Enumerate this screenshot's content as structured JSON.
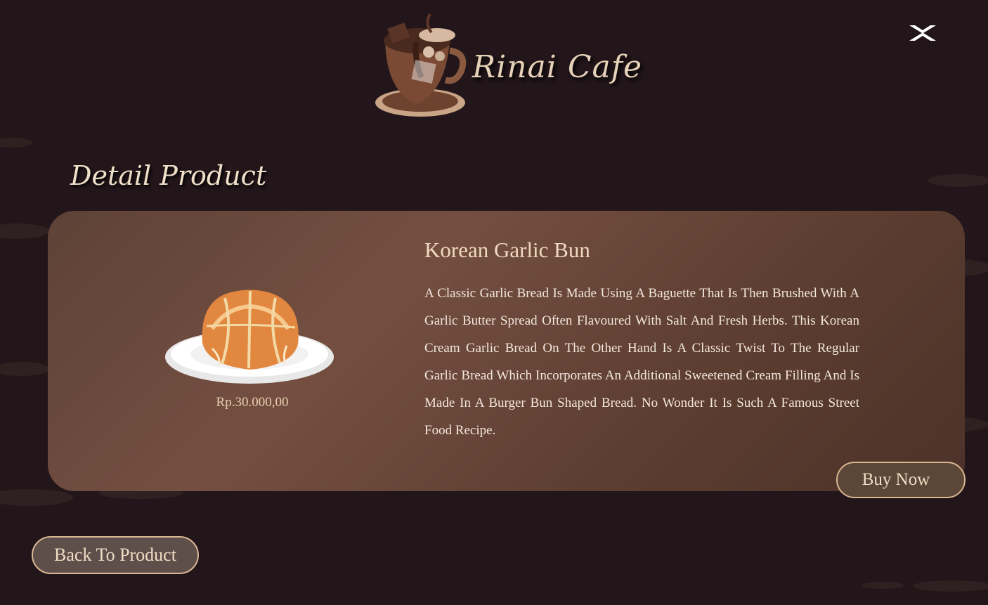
{
  "header": {
    "brand_name": "Rinai Cafe",
    "logo_icon": "coffee-cup-logo-icon",
    "close_icon": "close-icon"
  },
  "page": {
    "section_title": "Detail Product"
  },
  "product": {
    "name": "Korean Garlic Bun",
    "price": "Rp.30.000,00",
    "image_icon": "garlic-bun-image",
    "description": "A Classic Garlic Bread Is Made Using A Baguette That Is Then Brushed With A Garlic Butter Spread Often Flavoured With Salt And Fresh Herbs. This Korean Cream Garlic Bread On The Other Hand Is A Classic Twist To The Regular Garlic Bread Which Incorporates An Additional Sweetened Cream  Filling And Is Made In A Burger Bun Shaped Bread. No Wonder It Is Such A Famous Street Food Recipe."
  },
  "actions": {
    "buy_label": "Buy Now",
    "back_label": "Back To Product"
  },
  "colors": {
    "background": "#22161a",
    "card": "#6b4a3e",
    "accent_border": "#d9b692",
    "text_light": "#efdac1"
  }
}
